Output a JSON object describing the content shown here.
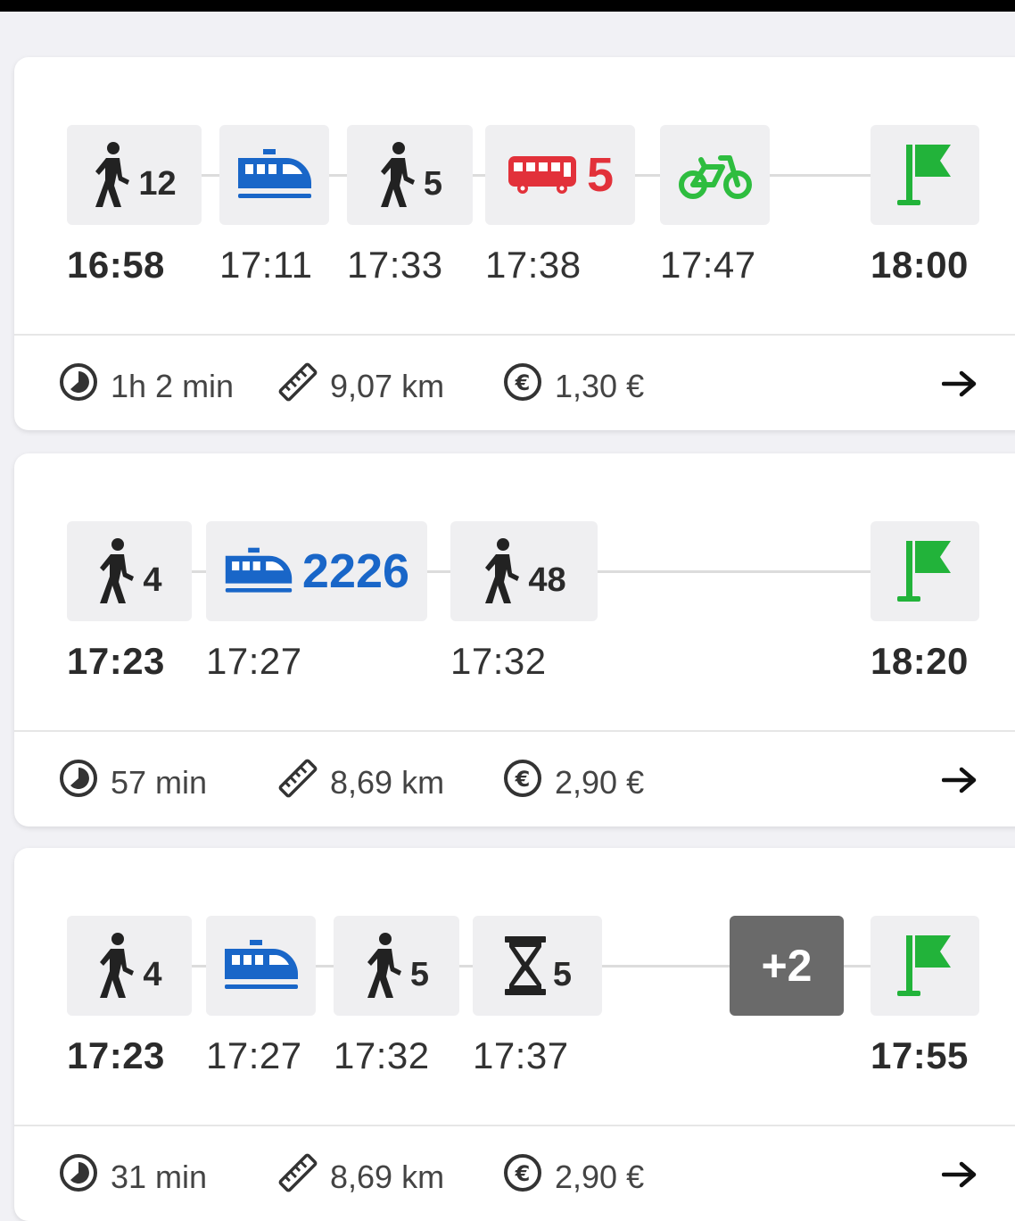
{
  "colors": {
    "walk": "#222222",
    "train": "#1966c8",
    "bus": "#e2313a",
    "bike": "#2ebd3f",
    "flag": "#22b33a",
    "more_badge": "#6a6a6a"
  },
  "trips": [
    {
      "legs": [
        {
          "icon": "walk-icon",
          "label": "12"
        },
        {
          "icon": "train-icon",
          "label": ""
        },
        {
          "icon": "walk-icon",
          "label": "5"
        },
        {
          "icon": "bus-icon",
          "label": "5"
        },
        {
          "icon": "bike-icon",
          "label": ""
        },
        {
          "icon": "flag-icon",
          "label": ""
        }
      ],
      "times": [
        "16:58",
        "17:11",
        "17:33",
        "17:38",
        "17:47",
        "18:00"
      ],
      "duration": "1h 2 min",
      "distance": "9,07 km",
      "price": "1,30 €"
    },
    {
      "legs": [
        {
          "icon": "walk-icon",
          "label": "4"
        },
        {
          "icon": "train-icon",
          "label": "2226"
        },
        {
          "icon": "walk-icon",
          "label": "48"
        },
        {
          "icon": "flag-icon",
          "label": ""
        }
      ],
      "times": [
        "17:23",
        "17:27",
        "17:32",
        "18:20"
      ],
      "duration": "57 min",
      "distance": "8,69 km",
      "price": "2,90 €"
    },
    {
      "legs": [
        {
          "icon": "walk-icon",
          "label": "4"
        },
        {
          "icon": "train-icon",
          "label": ""
        },
        {
          "icon": "walk-icon",
          "label": "5"
        },
        {
          "icon": "hourglass-icon",
          "label": "5"
        },
        {
          "icon": "more-badge",
          "label": "+2"
        },
        {
          "icon": "flag-icon",
          "label": ""
        }
      ],
      "times": [
        "17:23",
        "17:27",
        "17:32",
        "17:37",
        "17:55"
      ],
      "duration": "31 min",
      "distance": "8,69 km",
      "price": "2,90 €"
    }
  ]
}
